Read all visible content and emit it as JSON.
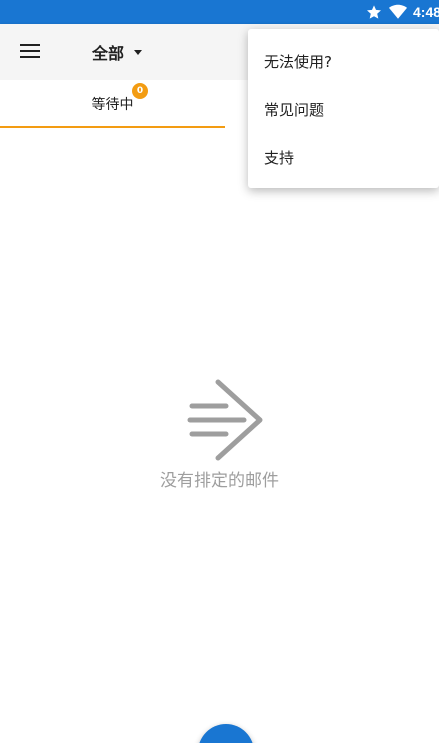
{
  "status_bar": {
    "time": "4:48",
    "icons": [
      "star-icon",
      "wifi-icon"
    ],
    "background": "#1976d2"
  },
  "app_bar": {
    "menu_icon": "hamburger-menu-icon",
    "filter_label": "全部",
    "dropdown_icon": "caret-down-icon"
  },
  "tabs": [
    {
      "label": "等待中",
      "badge": "0",
      "selected": true
    }
  ],
  "empty_state": {
    "icon": "send-arrow-icon",
    "message": "没有排定的邮件"
  },
  "overflow_menu": {
    "items": [
      {
        "label": "无法使用?"
      },
      {
        "label": "常见问题"
      },
      {
        "label": "支持"
      }
    ]
  },
  "colors": {
    "primary": "#1976d2",
    "accent": "#f39c12",
    "muted_text": "#9e9e9e"
  }
}
